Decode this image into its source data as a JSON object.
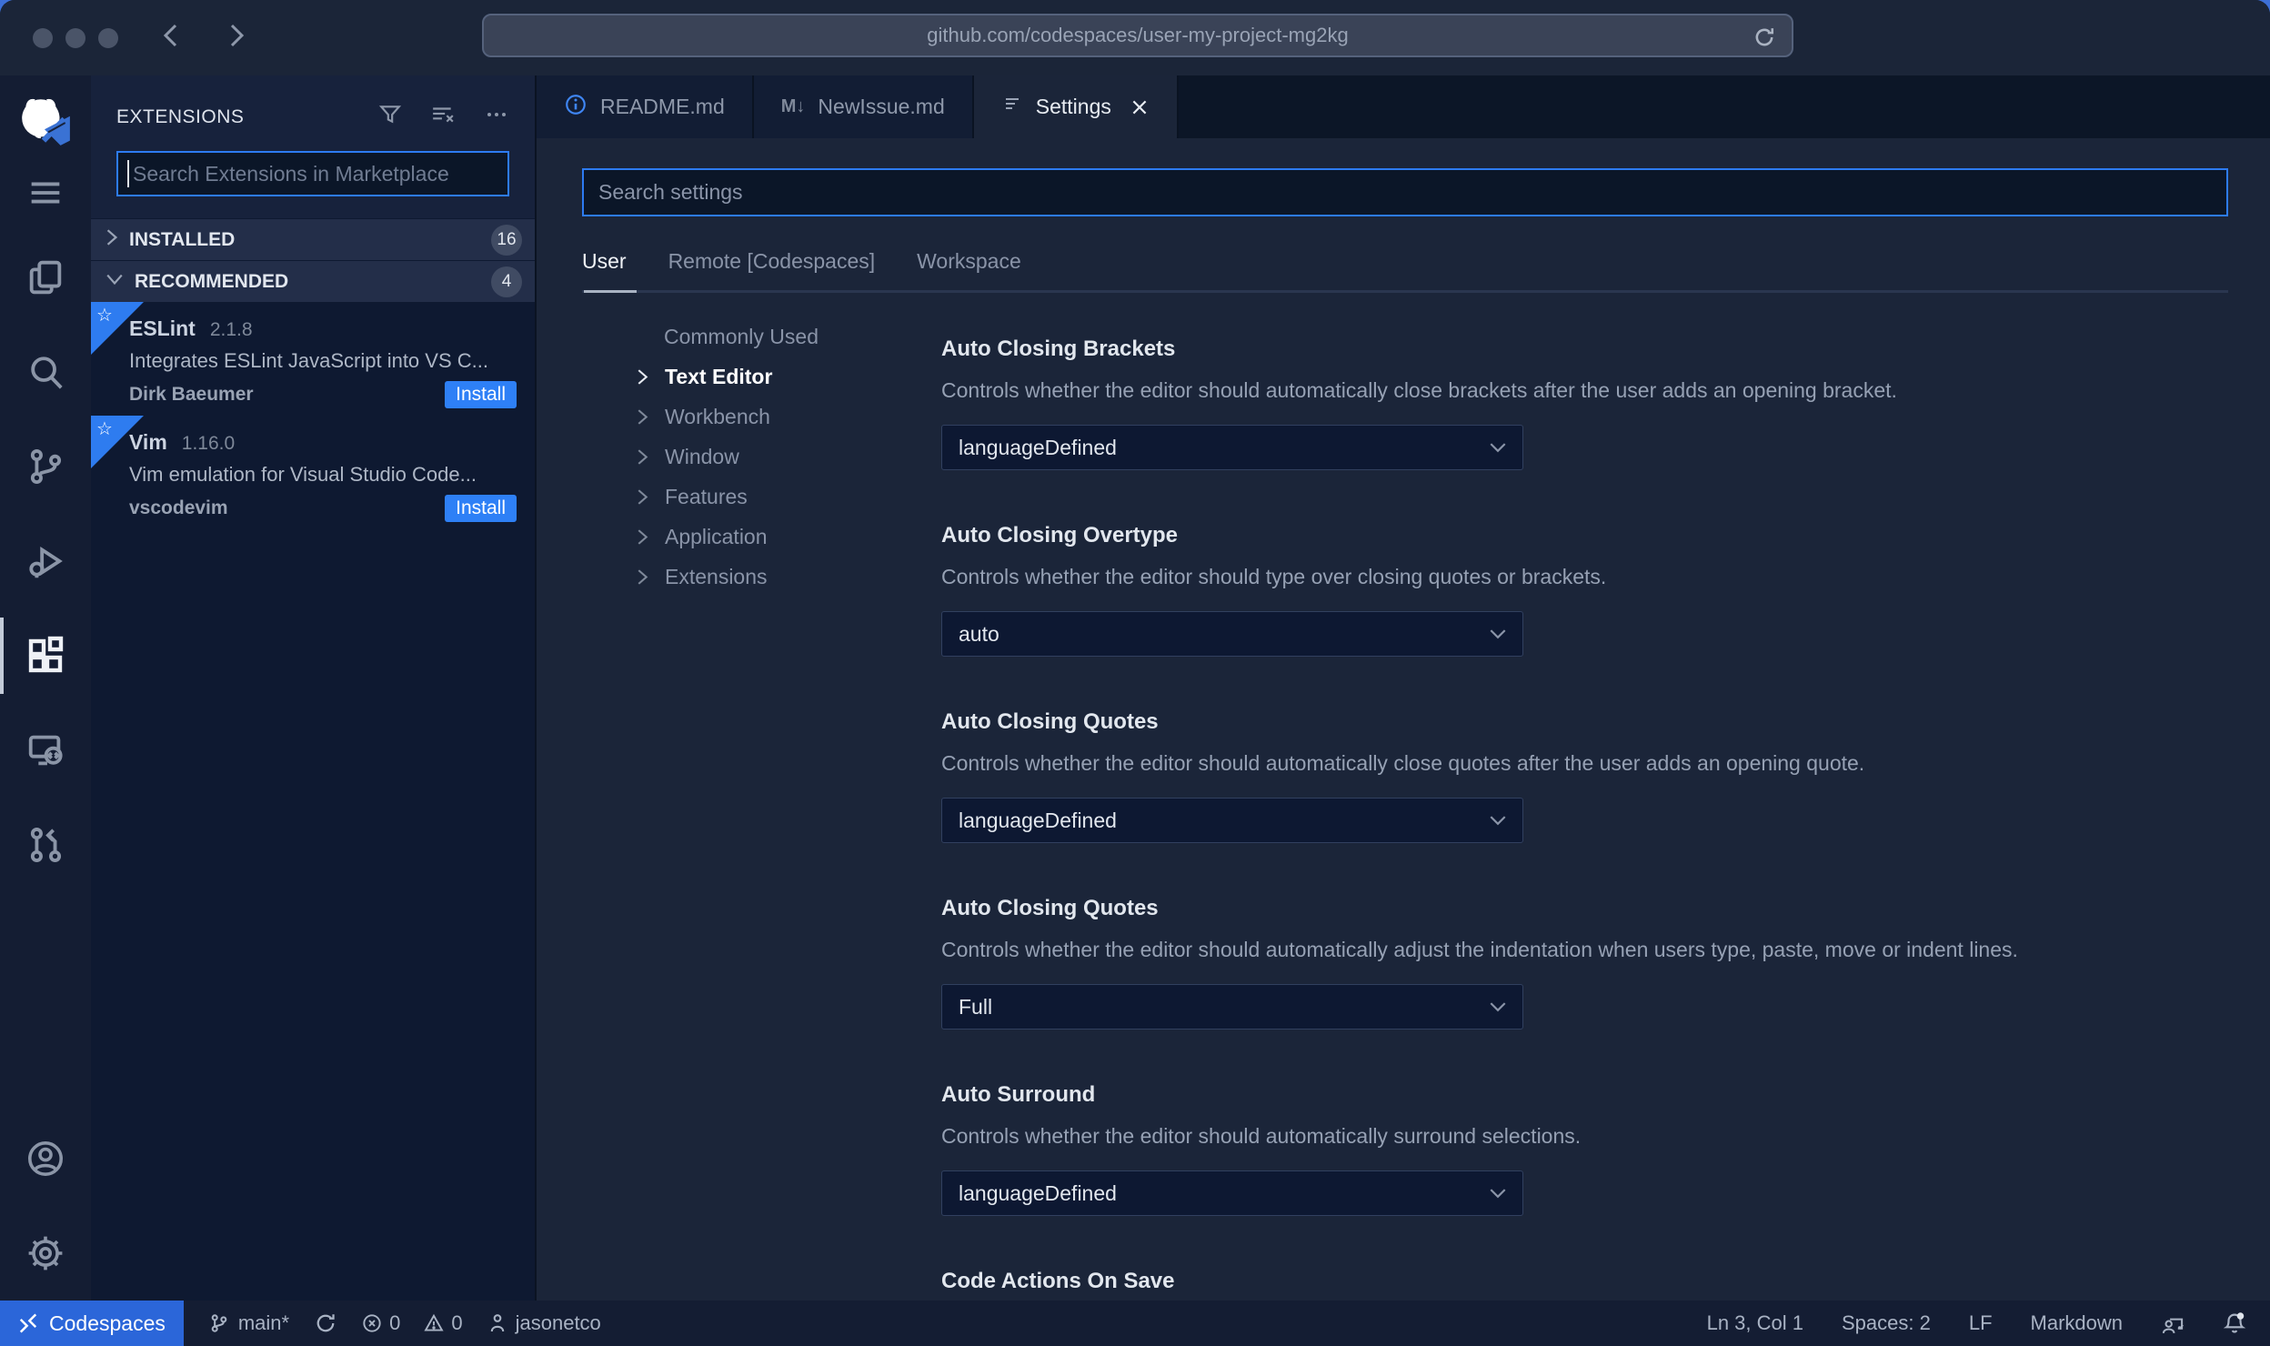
{
  "browser": {
    "url": "github.com/codespaces/user-my-project-mg2kg"
  },
  "icons": {
    "star": "☆",
    "markdown_tab": "M↓"
  },
  "colors": {
    "accent_blue": "#2d7bf2",
    "install_blue": "#2e80f6",
    "codespaces_blue": "#2b66d9",
    "ribbon_blue": "#2e7cf0",
    "editor_bg": "#1b2539",
    "sidebar_bg": "#17223c"
  },
  "sidebar": {
    "title": "EXTENSIONS",
    "search_placeholder": "Search Extensions in Marketplace",
    "sections": {
      "installed": {
        "label": "INSTALLED",
        "count": "16"
      },
      "recommended": {
        "label": "RECOMMENDED",
        "count": "4"
      }
    },
    "extensions": [
      {
        "name": "ESLint",
        "version": "2.1.8",
        "description": "Integrates ESLint JavaScript into VS C...",
        "author": "Dirk Baeumer",
        "action": "Install"
      },
      {
        "name": "Vim",
        "version": "1.16.0",
        "description": "Vim emulation for Visual Studio Code...",
        "author": "vscodevim",
        "action": "Install"
      }
    ]
  },
  "tabs": [
    {
      "label": "README.md"
    },
    {
      "label": "NewIssue.md"
    },
    {
      "label": "Settings"
    }
  ],
  "settings": {
    "search_placeholder": "Search settings",
    "scopes": [
      "User",
      "Remote [Codespaces]",
      "Workspace"
    ],
    "toc": [
      "Commonly Used",
      "Text Editor",
      "Workbench",
      "Window",
      "Features",
      "Application",
      "Extensions"
    ],
    "items": [
      {
        "title": "Auto Closing Brackets",
        "description": "Controls whether the editor should automatically close brackets after the user adds an opening bracket.",
        "value": "languageDefined"
      },
      {
        "title": "Auto Closing Overtype",
        "description": "Controls whether the editor should type over closing quotes or brackets.",
        "value": "auto"
      },
      {
        "title": "Auto Closing Quotes",
        "description": "Controls whether the editor should automatically close quotes after the user adds an opening quote.",
        "value": "languageDefined"
      },
      {
        "title": "Auto Closing Quotes",
        "description": "Controls whether the editor should automatically adjust the indentation when users type, paste, move or indent lines.",
        "value": "Full"
      },
      {
        "title": "Auto Surround",
        "description": "Controls whether the editor should automatically surround selections.",
        "value": "languageDefined"
      },
      {
        "title": "Code Actions On Save",
        "description": "",
        "value": ""
      }
    ]
  },
  "status_bar": {
    "codespaces": "Codespaces",
    "branch": "main*",
    "errors": "0",
    "warnings": "0",
    "user": "jasonetco",
    "cursor": "Ln 3, Col 1",
    "indent": "Spaces: 2",
    "eol": "LF",
    "language": "Markdown"
  }
}
